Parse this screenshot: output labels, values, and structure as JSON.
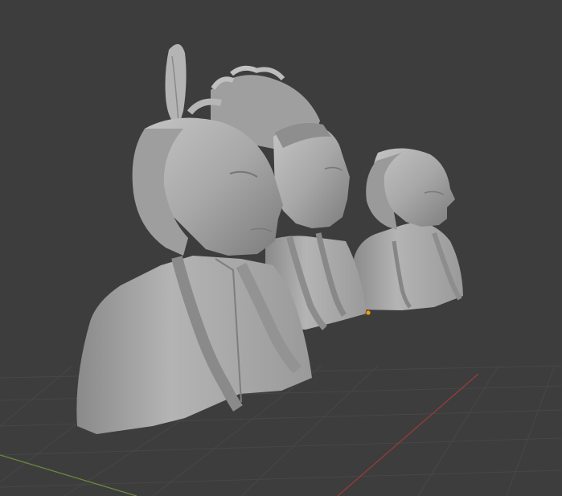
{
  "viewport": {
    "mode": "solid",
    "background": "#3d3d3d",
    "grid_color": "#474747",
    "x_axis_color": "#9a3a3a",
    "y_axis_color": "#6a8a3a",
    "origin_color": "#e8a020",
    "model_color": "#a9a9a9",
    "objects": [
      {
        "name": "bust-near"
      },
      {
        "name": "bust-headdress"
      },
      {
        "name": "bust-far"
      }
    ]
  }
}
